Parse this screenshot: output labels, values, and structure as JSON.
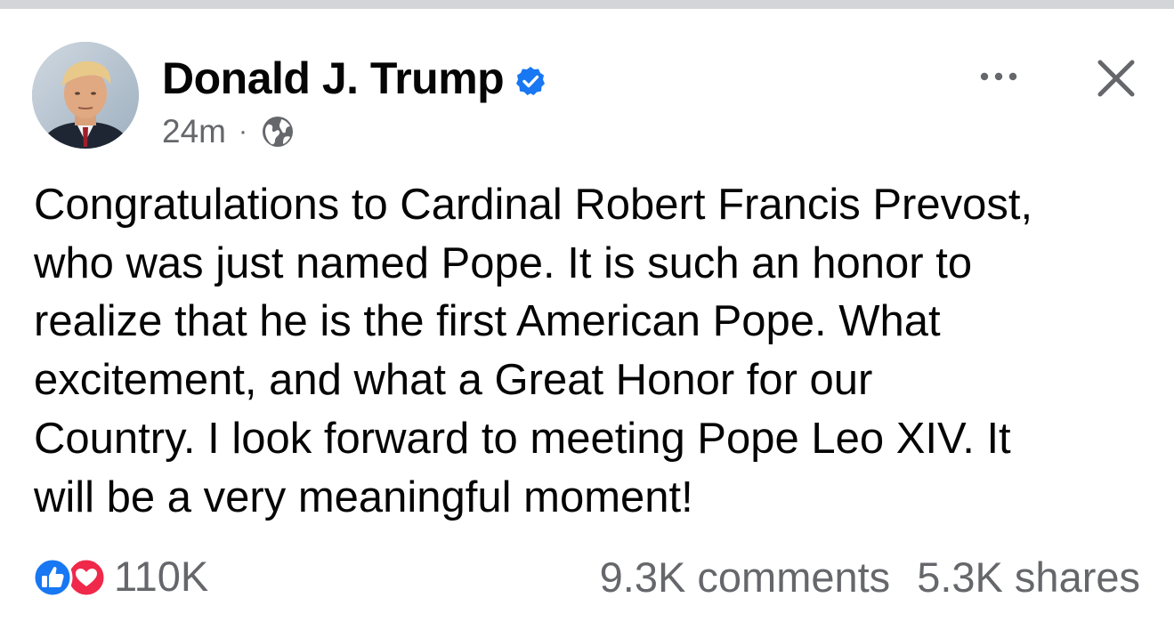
{
  "post": {
    "author": "Donald J. Trump",
    "verified_icon": "verified-badge-icon",
    "timestamp": "24m",
    "separator": "·",
    "audience_icon": "globe-icon",
    "body": "Congratulations to Cardinal Robert Francis Prevost,\nwho was just named Pope. It is such an honor to\nrealize that he is the first American Pope. What\nexcitement, and what a Great Honor for our\nCountry. I look forward to meeting Pope Leo XIV. It\nwill be a very meaningful moment!",
    "reactions": {
      "icons": [
        "like-icon",
        "love-icon"
      ],
      "count": "110K"
    },
    "comments": "9.3K comments",
    "shares": "5.3K shares"
  },
  "header_actions": {
    "more_icon": "more-options-icon",
    "close_icon": "close-icon"
  },
  "colors": {
    "text_primary": "#050505",
    "text_secondary": "#65676b",
    "verified_blue": "#1877f2",
    "like_blue": "#1877f2",
    "love_red": "#f02849",
    "top_strip": "#d3d5d9"
  }
}
